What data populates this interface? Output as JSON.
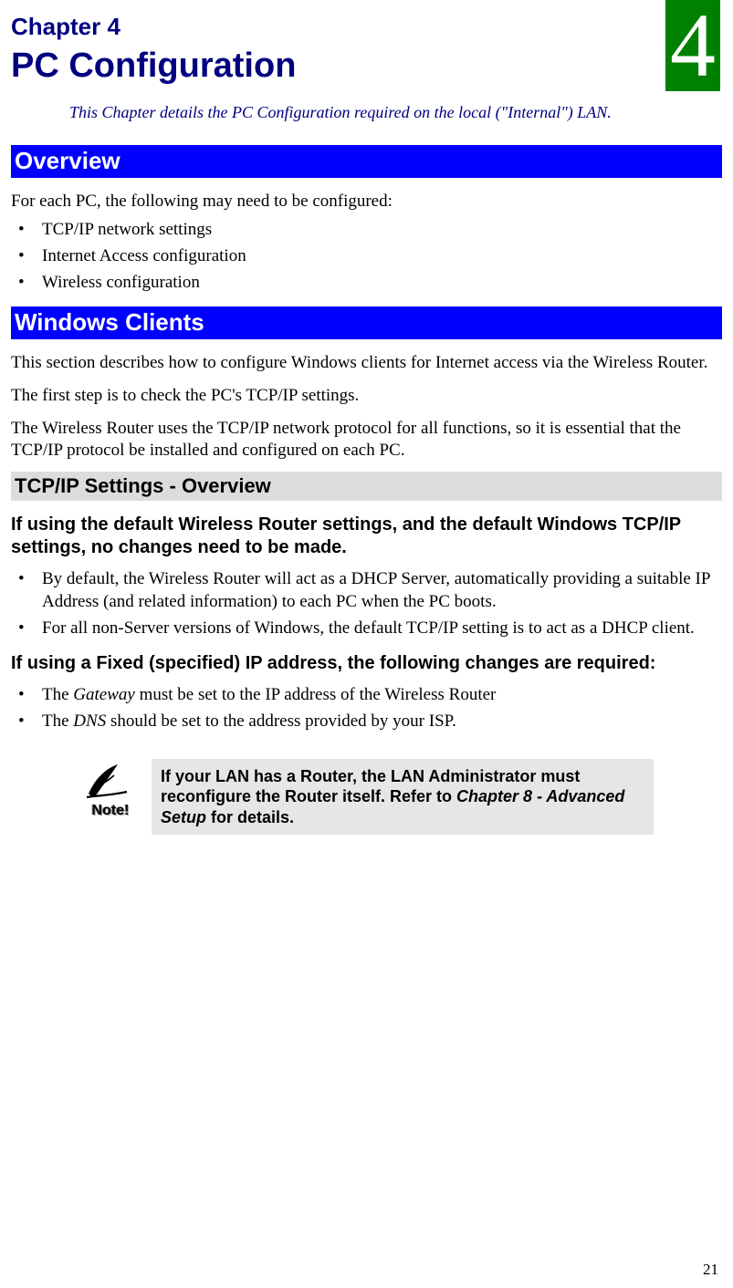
{
  "chapter": {
    "label": "Chapter 4",
    "title": "PC Configuration",
    "number_badge": "4",
    "subtitle": "This Chapter details the PC Configuration required on the local (\"Internal\") LAN."
  },
  "overview": {
    "heading": "Overview",
    "intro": "For each PC, the following may need to be configured:",
    "items": [
      "TCP/IP network settings",
      "Internet Access configuration",
      "Wireless configuration"
    ]
  },
  "windows_clients": {
    "heading": "Windows Clients",
    "p1": "This section describes how to configure Windows clients for Internet access via the Wireless Router.",
    "p2": "The first step is to check the PC's TCP/IP settings.",
    "p3": "The Wireless Router uses the TCP/IP network protocol for all functions, so it is essential that the TCP/IP protocol be installed and configured on each PC."
  },
  "tcpip": {
    "heading": "TCP/IP Settings - Overview",
    "defaults_heading": "If using the default Wireless Router settings, and the default Windows TCP/IP settings, no changes need to be made.",
    "defaults_items": [
      "By default, the Wireless Router will act as a DHCP Server, automatically providing a suitable IP Address (and related information) to each PC when the PC boots.",
      "For all non-Server versions of Windows, the default TCP/IP setting is to act as a DHCP client."
    ],
    "fixed_heading": "If using a Fixed (specified) IP address, the following changes are required:",
    "fixed_items": [
      {
        "prefix": "The ",
        "em": "Gateway",
        "suffix": " must be set to the IP address of the Wireless Router"
      },
      {
        "prefix": "The ",
        "em": "DNS",
        "suffix": " should be set to the address provided by your ISP."
      }
    ]
  },
  "note": {
    "label": "Note!",
    "chapter_ref": "Chapter 8 - Advanced Setup",
    "pre": "If your LAN has a Router, the LAN Administrator must reconfigure the Router itself. Refer to ",
    "post": " for details."
  },
  "page_number": "21"
}
